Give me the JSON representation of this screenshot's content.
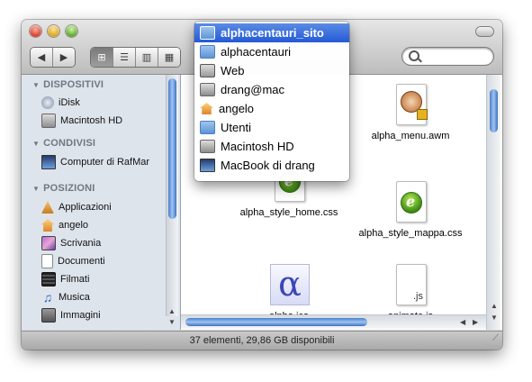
{
  "window": {
    "status_text": "37 elementi, 29,86 GB disponibili"
  },
  "toolbar": {
    "back_label": "◀",
    "forward_label": "▶",
    "view_icons_label": "⊞",
    "view_list_label": "☰",
    "view_columns_label": "▥",
    "view_coverflow_label": "▦",
    "search_placeholder": ""
  },
  "path_menu": {
    "items": [
      {
        "label": "alphacentauri_sito",
        "icon": "folder-icon",
        "selected": true
      },
      {
        "label": "alphacentauri",
        "icon": "folder-icon"
      },
      {
        "label": "Web",
        "icon": "web-folder-icon"
      },
      {
        "label": "drang@mac",
        "icon": "drive-icon"
      },
      {
        "label": "angelo",
        "icon": "home-icon"
      },
      {
        "label": "Utenti",
        "icon": "folder-icon"
      },
      {
        "label": "Macintosh HD",
        "icon": "hard-drive-icon"
      },
      {
        "label": "MacBook di drang",
        "icon": "computer-icon"
      }
    ]
  },
  "sidebar": {
    "sections": [
      {
        "title": "DISPOSITIVI",
        "items": [
          {
            "label": "iDisk",
            "icon": "idisk-icon"
          },
          {
            "label": "Macintosh HD",
            "icon": "hard-drive-icon"
          }
        ]
      },
      {
        "title": "CONDIVISI",
        "items": [
          {
            "label": "Computer di RafMar",
            "icon": "computer-icon"
          }
        ]
      },
      {
        "title": "POSIZIONI",
        "items": [
          {
            "label": "Applicazioni",
            "icon": "applications-icon"
          },
          {
            "label": "angelo",
            "icon": "home-icon"
          },
          {
            "label": "Scrivania",
            "icon": "desktop-icon"
          },
          {
            "label": "Documenti",
            "icon": "documents-icon"
          },
          {
            "label": "Filmati",
            "icon": "movies-icon"
          },
          {
            "label": "Musica",
            "icon": "music-icon"
          },
          {
            "label": "Immagini",
            "icon": "pictures-icon"
          }
        ]
      }
    ]
  },
  "files": [
    {
      "name": "alpha_menu.awm",
      "icon": "awm-file-icon"
    },
    {
      "name": "alpha_style_home.css",
      "icon": "dreamweaver-css-icon"
    },
    {
      "name": "alpha_style_mappa.css",
      "icon": "dreamweaver-css-icon"
    },
    {
      "name": "alpha.ico",
      "icon": "alpha-ico-icon"
    },
    {
      "name": "animate.js",
      "icon": "js-file-icon"
    }
  ],
  "file_icon_text": {
    "ico_glyph": "α",
    "js_label": ".js"
  }
}
